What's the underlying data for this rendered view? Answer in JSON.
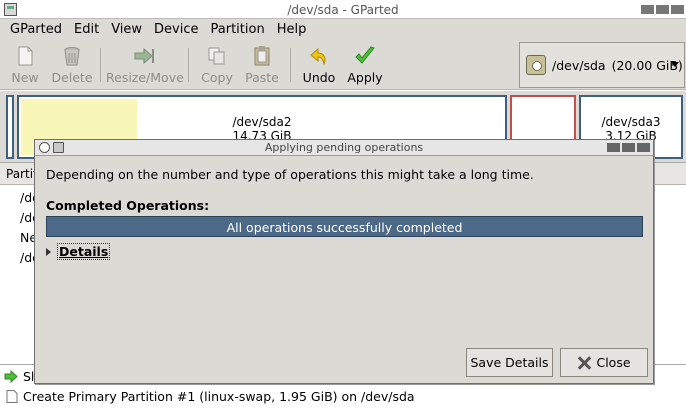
{
  "window": {
    "title": "/dev/sda - GParted"
  },
  "menu": [
    "GParted",
    "Edit",
    "View",
    "Device",
    "Partition",
    "Help"
  ],
  "toolbar": {
    "new": "New",
    "delete": "Delete",
    "resize": "Resize/Move",
    "copy": "Copy",
    "paste": "Paste",
    "undo": "Undo",
    "apply": "Apply"
  },
  "device_selector": {
    "device": "/dev/sda",
    "size": "(20.00 GiB)"
  },
  "diskmap": {
    "partitions": [
      {
        "name": "/dev/sda2",
        "size": "14.73 GiB"
      },
      {
        "name": "/dev/sda3",
        "size": "3.12 GiB"
      }
    ]
  },
  "partition_list": {
    "header": "Partiti",
    "rows": [
      "/de",
      "/de",
      "Ne",
      "/de"
    ]
  },
  "operations": {
    "items": [
      "Sl",
      "Create Primary Partition #1 (linux-swap, 1.95 GiB) on /dev/sda"
    ]
  },
  "dialog": {
    "title": "Applying pending operations",
    "description": "Depending on the number and type of operations this might take a long time.",
    "completed_label": "Completed Operations:",
    "progress": {
      "fraction": 1.0,
      "text": "All operations successfully completed"
    },
    "details_label": "Details",
    "save_details": "Save Details",
    "close": "Close"
  },
  "colors": {
    "selection": "#4c6a87",
    "unallocated_fill": "#f8f7b8",
    "partition_border": "#3e5f7e",
    "swap_border": "#c0504d",
    "apply_icon": "#3aa53a",
    "undo_icon": "#e6b800"
  }
}
